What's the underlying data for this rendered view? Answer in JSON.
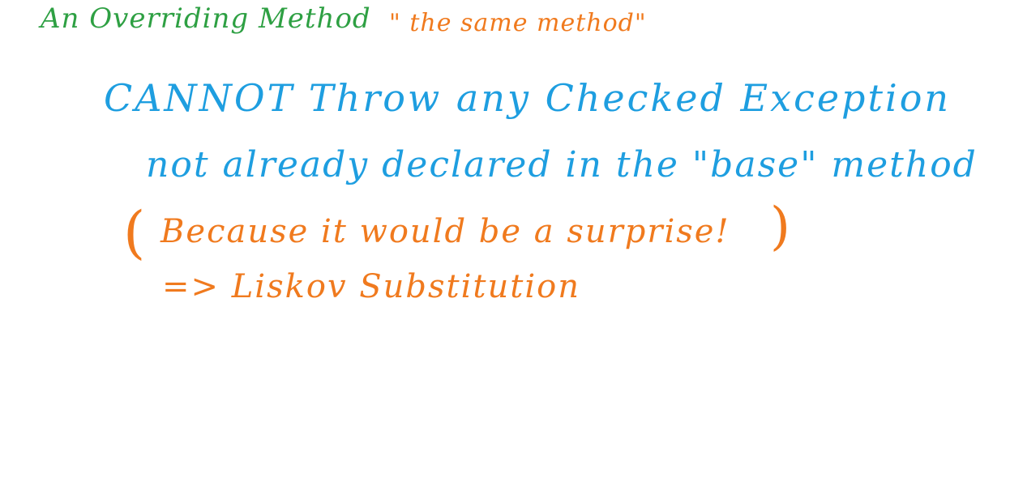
{
  "colors": {
    "green": "#2ea043",
    "orange": "#f07a1e",
    "blue": "#1e9ee0"
  },
  "notes": {
    "title_main": "An Overriding Method",
    "title_quote": "\" the same method\"",
    "line1": "CANNOT Throw any Checked Exception",
    "line2": "not already declared in the \"base\" method",
    "paren_open": "(",
    "line3": "Because it would be a surprise!",
    "paren_close": ")",
    "line4": "=> Liskov Substitution"
  }
}
